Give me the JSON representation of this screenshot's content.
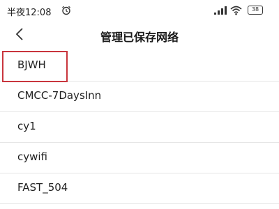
{
  "statusbar": {
    "time": "半夜12:08",
    "battery": "38"
  },
  "header": {
    "title": "管理已保存网络"
  },
  "networks": [
    {
      "name": "BJWH",
      "highlighted": true
    },
    {
      "name": "CMCC-7DaysInn",
      "highlighted": false
    },
    {
      "name": "cy1",
      "highlighted": false
    },
    {
      "name": "cywifi",
      "highlighted": false
    },
    {
      "name": "FAST_504",
      "highlighted": false
    }
  ],
  "colors": {
    "highlight": "#c9353d",
    "divider": "#e6e6e6"
  }
}
